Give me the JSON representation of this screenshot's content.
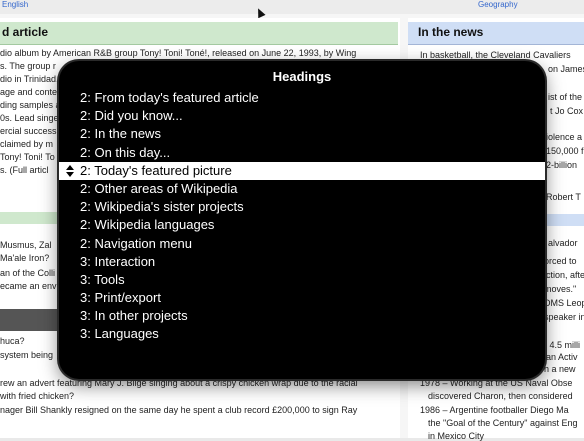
{
  "background_page": {
    "top_links": [
      "English",
      "Geography"
    ],
    "left_header": "d article",
    "right_header": "In the news",
    "left_lines": [
      "dio album by American R&B group Tony! Toni! Toné!, released on June 22, 1993, by Wing",
      "s. The group r",
      "dio in Trinidad,",
      "age and conte",
      "ding samples a",
      "0s. Lead singe",
      "ercial success,",
      "claimed by m",
      "Tony! Toni! To",
      "s. (Full articl",
      "Musmus, Zal",
      "Ma'ale Iron?",
      "an of the Colli",
      "ecame an env",
      "huca?",
      "system being",
      "rew an advert featuring Mary J. Blige singing about a crispy chicken wrap due to the racial",
      "with fried chicken?",
      "nager Bill Shankly resigned on the same day he spent a club record £200,000 to sign Ray"
    ],
    "right_lines": [
      "In basketball, the Cleveland Cavaliers",
      "on James",
      "ist of the",
      "t Jo Cox",
      "iolence a",
      "150,000 f",
      "2-billion",
      "Robert T",
      "alvador",
      "orced to",
      "iction, afte",
      "moves.\"",
      "DMS Leop",
      "speaker in",
      "r 4.5 milli",
      "ian Activ",
      "h a new",
      "1978 – Working at the US Naval Obse",
      "discovered Charon, then considered",
      "1986 – Argentine footballer Diego Ma",
      "the \"Goal of the Century\" against Eng",
      "in Mexico City"
    ]
  },
  "rotor": {
    "title": "Headings",
    "selected_index": 4,
    "items": [
      "2: From today's featured article",
      "2: Did you know...",
      "2: In the news",
      "2: On this day...",
      "2: Today's featured picture",
      "2: Other areas of Wikipedia",
      "2: Wikipedia's sister projects",
      "2: Wikipedia languages",
      "2: Navigation menu",
      "3: Interaction",
      "3: Tools",
      "3: Print/export",
      "3: In other projects",
      "3: Languages"
    ]
  }
}
